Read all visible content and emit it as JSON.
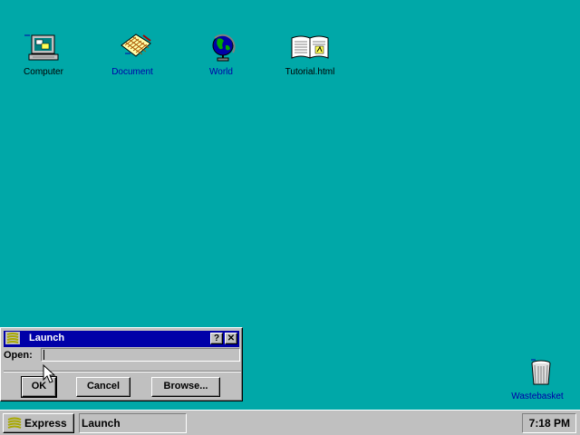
{
  "desktop": {
    "icons": [
      {
        "name": "computer",
        "label": "Computer",
        "label_color": "#000000"
      },
      {
        "name": "document",
        "label": "Document",
        "label_color": "#0000A8"
      },
      {
        "name": "world",
        "label": "World",
        "label_color": "#0000A8"
      },
      {
        "name": "tutorial",
        "label": "Tutorial.html",
        "label_color": "#000000"
      },
      {
        "name": "wastebasket",
        "label": "Wastebasket",
        "label_color": "#0000A8"
      }
    ],
    "background_color": "#00A8A8"
  },
  "dialog": {
    "title": "Launch",
    "help_label": "?",
    "close_label": "✕",
    "open_label": "Open:",
    "open_value": "",
    "ok_label": "OK",
    "cancel_label": "Cancel",
    "browse_label": "Browse..."
  },
  "taskbar": {
    "start_label": "Express",
    "task_label": "Launch",
    "clock": "7:18 PM"
  },
  "colors": {
    "titlebar": "#0000A8",
    "face": "#C0C0C0"
  }
}
